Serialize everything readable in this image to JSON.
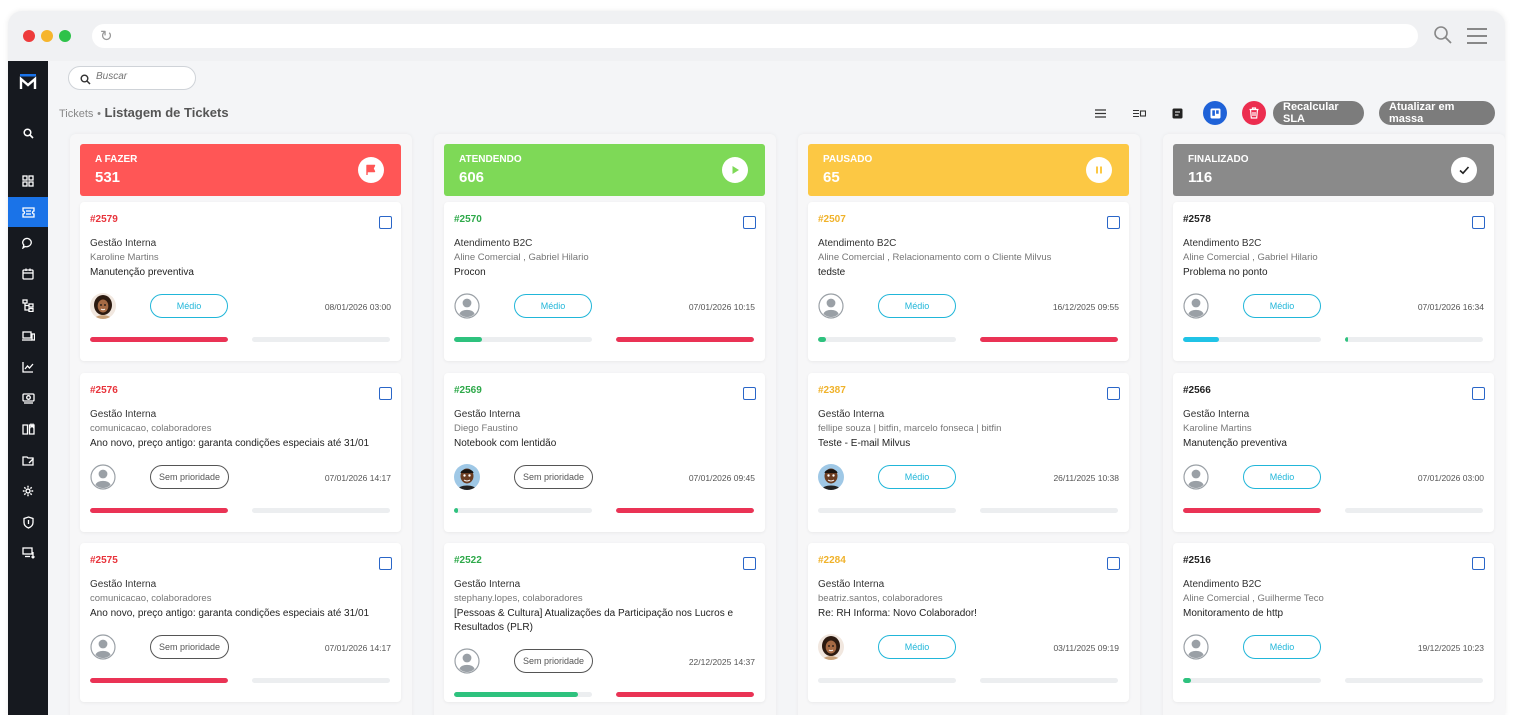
{
  "search": {
    "placeholder": "Buscar"
  },
  "breadcrumb": {
    "parent": "Tickets",
    "separator": "•",
    "current": "Listagem de Tickets"
  },
  "toolbar": {
    "recalc_label": "Recalcular SLA",
    "mass_update_label": "Atualizar em massa"
  },
  "icons": {
    "list_view": "list-icon",
    "compact_view": "compact-list-icon",
    "table_view": "table-icon",
    "kanban_view": "kanban-icon",
    "delete": "trash-icon"
  },
  "colors": {
    "a_fazer": "#ff5656",
    "atendendo": "#7ed957",
    "pausado": "#fcc844",
    "finalizado": "#8a8a8a",
    "medio": "#21b6d9",
    "sla_red": "#ea3355",
    "sla_green": "#2ec27e",
    "sla_cyan": "#20c3e6"
  },
  "columns": [
    {
      "key": "a_fazer",
      "title": "A FAZER",
      "count": "531",
      "icon": "flag-icon",
      "cards": [
        {
          "id": "#2579",
          "dept": "Gestão Interna",
          "people": "Karoline Martins",
          "subject": "Manutenção preventiva",
          "priority": "Médio",
          "date": "08/01/2026 03:00",
          "avatar": "female-photo",
          "sla1": 1.0,
          "sla2": 0.0
        },
        {
          "id": "#2576",
          "dept": "Gestão Interna",
          "people": "comunicacao, colaboradores",
          "subject": "Ano novo, preço antigo: garanta condições especiais até 31/01",
          "priority": "Sem prioridade",
          "date": "07/01/2026 14:17",
          "avatar": "default",
          "sla1": 1.0,
          "sla2": 0.0
        },
        {
          "id": "#2575",
          "dept": "Gestão Interna",
          "people": "comunicacao, colaboradores",
          "subject": "Ano novo, preço antigo: garanta condições especiais até 31/01",
          "priority": "Sem prioridade",
          "date": "07/01/2026 14:17",
          "avatar": "default",
          "sla1": 1.0,
          "sla2": 0.0
        }
      ]
    },
    {
      "key": "atendendo",
      "title": "ATENDENDO",
      "count": "606",
      "icon": "play-icon",
      "cards": [
        {
          "id": "#2570",
          "dept": "Atendimento B2C",
          "people": "Aline Comercial , Gabriel Hilario",
          "subject": "Procon",
          "priority": "Médio",
          "date": "07/01/2026 10:15",
          "avatar": "default",
          "sla1": 0.2,
          "sla2": 1.0
        },
        {
          "id": "#2569",
          "dept": "Gestão Interna",
          "people": "Diego Faustino",
          "subject": "Notebook com lentidão",
          "priority": "Sem prioridade",
          "date": "07/01/2026 09:45",
          "avatar": "male-photo",
          "sla1": 0.03,
          "sla2": 1.0
        },
        {
          "id": "#2522",
          "dept": "Gestão Interna",
          "people": "stephany.lopes, colaboradores",
          "subject": "[Pessoas & Cultura] Atualizações da Participação nos Lucros e Resultados (PLR)",
          "priority": "Sem prioridade",
          "date": "22/12/2025 14:37",
          "avatar": "default",
          "sla1": 0.9,
          "sla2": 1.0
        }
      ]
    },
    {
      "key": "pausado",
      "title": "PAUSADO",
      "count": "65",
      "icon": "pause-icon",
      "cards": [
        {
          "id": "#2507",
          "dept": "Atendimento B2C",
          "people": "Aline Comercial , Relacionamento com o Cliente Milvus",
          "subject": "tedste",
          "priority": "Médio",
          "date": "16/12/2025 09:55",
          "avatar": "default",
          "sla1": 0.06,
          "sla2": 1.0
        },
        {
          "id": "#2387",
          "dept": "Gestão Interna",
          "people": "fellipe souza | bitfin, marcelo fonseca | bitfin",
          "subject": "Teste - E-mail Milvus",
          "priority": "Médio",
          "date": "26/11/2025 10:38",
          "avatar": "male-photo",
          "sla1": 0.0,
          "sla2": 0.0
        },
        {
          "id": "#2284",
          "dept": "Gestão Interna",
          "people": "beatriz.santos, colaboradores",
          "subject": "Re: RH Informa: Novo Colaborador!",
          "priority": "Médio",
          "date": "03/11/2025 09:19",
          "avatar": "female-photo",
          "sla1": 0.0,
          "sla2": 0.0
        }
      ]
    },
    {
      "key": "finalizado",
      "title": "FINALIZADO",
      "count": "116",
      "icon": "check-icon",
      "cards": [
        {
          "id": "#2578",
          "dept": "Atendimento B2C",
          "people": "Aline Comercial , Gabriel Hilario",
          "subject": "Problema no ponto",
          "priority": "Médio",
          "date": "07/01/2026 16:34",
          "avatar": "default",
          "sla1": 0.26,
          "sla2": 0.02
        },
        {
          "id": "#2566",
          "dept": "Gestão Interna",
          "people": "Karoline Martins",
          "subject": "Manutenção preventiva",
          "priority": "Médio",
          "date": "07/01/2026 03:00",
          "avatar": "default",
          "sla1": 1.0,
          "sla2": 0.0
        },
        {
          "id": "#2516",
          "dept": "Atendimento B2C",
          "people": "Aline Comercial , Guilherme Teco",
          "subject": "Monitoramento de http",
          "priority": "Médio",
          "date": "19/12/2025 10:23",
          "avatar": "default",
          "sla1": 0.06,
          "sla2": 0.0
        }
      ]
    }
  ]
}
